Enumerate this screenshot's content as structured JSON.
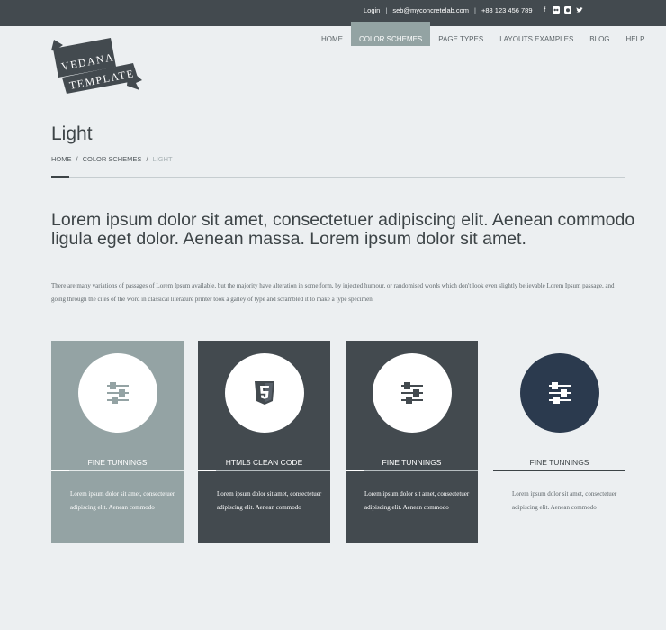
{
  "topbar": {
    "login": "Login",
    "email": "seb@myconcretelab.com",
    "phone": "+88 123 456 789",
    "social_icons": [
      "facebook-icon",
      "flickr-icon",
      "github-icon",
      "twitter-icon"
    ]
  },
  "logo": {
    "line1": "VEDANA",
    "line2": "TEMPLATE"
  },
  "nav": {
    "items": [
      "HOME",
      "COLOR SCHEMES",
      "PAGE TYPES",
      "LAYOUTS EXAMPLES",
      "BLOG",
      "HELP"
    ],
    "active_index": 1
  },
  "page": {
    "title": "Light",
    "breadcrumb": [
      "HOME",
      "COLOR SCHEMES",
      "LIGHT"
    ],
    "breadcrumb_sep": "/",
    "lead": "Lorem ipsum dolor sit amet, consectetuer adipiscing elit. Aenean commodo ligula eget dolor. Aenean massa. Lorem ipsum dolor sit amet.",
    "body": "There are many variations of passages of Lorem Ipsum available, but the majority have alteration in some form, by injected humour, or randomised words which don't look even slightly believable Lorem Ipsum passage, and going through the cites of the word in classical literature printer took a galley of type and scrambled it to make a type specimen."
  },
  "cards": [
    {
      "title": "FINE TUNNINGS",
      "text": "Lorem ipsum dolor sit amet, consectetuer adipiscing elit. Aenean commodo",
      "icon": "sliders-icon",
      "style": "sage",
      "icon_color": "#94a3a4"
    },
    {
      "title": "HTML5 CLEAN CODE",
      "text": "Lorem ipsum dolor sit amet, consectetuer adipiscing elit. Aenean commodo",
      "icon": "html5-icon",
      "style": "dark",
      "icon_color": "#434a4f"
    },
    {
      "title": "FINE TUNNINGS",
      "text": "Lorem ipsum dolor sit amet, consectetuer adipiscing elit. Aenean commodo",
      "icon": "sliders-icon",
      "style": "dark",
      "icon_color": "#434a4f"
    },
    {
      "title": "FINE TUNNINGS",
      "text": "Lorem ipsum dolor sit amet, consectetuer adipiscing elit. Aenean commodo",
      "icon": "sliders-icon",
      "style": "light",
      "icon_color": "#ffffff"
    }
  ],
  "colors": {
    "topbar": "#434a4f",
    "accent": "#94a3a4",
    "background": "#eceff1",
    "navy": "#2b3a4e"
  }
}
